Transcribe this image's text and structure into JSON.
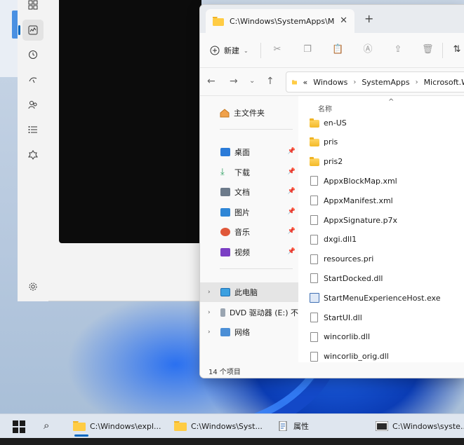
{
  "explorer": {
    "tab_title": "C:\\Windows\\SystemApps\\Mic",
    "tab_close": "✕",
    "new_tab": "+",
    "toolbar": {
      "new_label": "新建"
    },
    "breadcrumb": [
      "«",
      "Windows",
      "SystemApps",
      "Microsoft.W"
    ],
    "nav": {
      "home": "主文件夹",
      "quick": [
        {
          "label": "桌面",
          "color": "#2b7bd8"
        },
        {
          "label": "下载",
          "color": "#2a9d5f"
        },
        {
          "label": "文档",
          "color": "#6c7a8a"
        },
        {
          "label": "图片",
          "color": "#2f86d6"
        },
        {
          "label": "音乐",
          "color": "#e0583a"
        },
        {
          "label": "视频",
          "color": "#7b3fc4"
        }
      ],
      "tree": [
        {
          "label": "此电脑"
        },
        {
          "label": "DVD 驱动器 (E:) 不"
        },
        {
          "label": "网络"
        }
      ]
    },
    "column_header": "名称",
    "files": [
      {
        "name": "en-US",
        "type": "folder"
      },
      {
        "name": "pris",
        "type": "folder"
      },
      {
        "name": "pris2",
        "type": "folder"
      },
      {
        "name": "AppxBlockMap.xml",
        "type": "doc"
      },
      {
        "name": "AppxManifest.xml",
        "type": "doc"
      },
      {
        "name": "AppxSignature.p7x",
        "type": "doc"
      },
      {
        "name": "dxgi.dll1",
        "type": "doc"
      },
      {
        "name": "resources.pri",
        "type": "doc"
      },
      {
        "name": "StartDocked.dll",
        "type": "dll"
      },
      {
        "name": "StartMenuExperienceHost.exe",
        "type": "exe"
      },
      {
        "name": "StartUI.dll",
        "type": "dll"
      },
      {
        "name": "wincorlib.dll",
        "type": "dll"
      },
      {
        "name": "wincorlib_orig.dll",
        "type": "dll"
      }
    ],
    "status": "14 个项目"
  },
  "taskbar": {
    "items": [
      {
        "label": "C:\\Windows\\expl..."
      },
      {
        "label": "C:\\Windows\\Syst..."
      },
      {
        "label": "属性"
      },
      {
        "label": "C:\\Windows\\syste..."
      }
    ]
  },
  "colors": {
    "accent": "#0067c0",
    "folder": "#f3b928",
    "background_dark": "#0c0c0c"
  }
}
